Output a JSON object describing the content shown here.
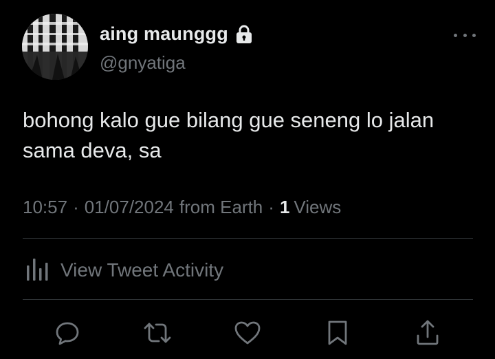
{
  "user": {
    "display_name": "aing maunggg",
    "handle": "@gnyatiga",
    "protected_icon": "lock-icon",
    "avatar": "avatar"
  },
  "tweet": {
    "text": "bohong kalo gue bilang gue seneng lo jalan sama deva, sa"
  },
  "meta": {
    "time": "10:57",
    "separator": "·",
    "date": "01/07/2024",
    "source": "from Earth",
    "views_count": "1",
    "views_label": "Views"
  },
  "activity": {
    "icon": "bar-chart-icon",
    "label": "View Tweet Activity"
  },
  "actions": [
    "reply-icon",
    "retweet-icon",
    "like-icon",
    "bookmark-icon",
    "share-icon"
  ],
  "colors": {
    "background": "#000000",
    "primary_text": "#e7e9ea",
    "secondary_text": "#71767b",
    "divider": "#2f3336"
  }
}
